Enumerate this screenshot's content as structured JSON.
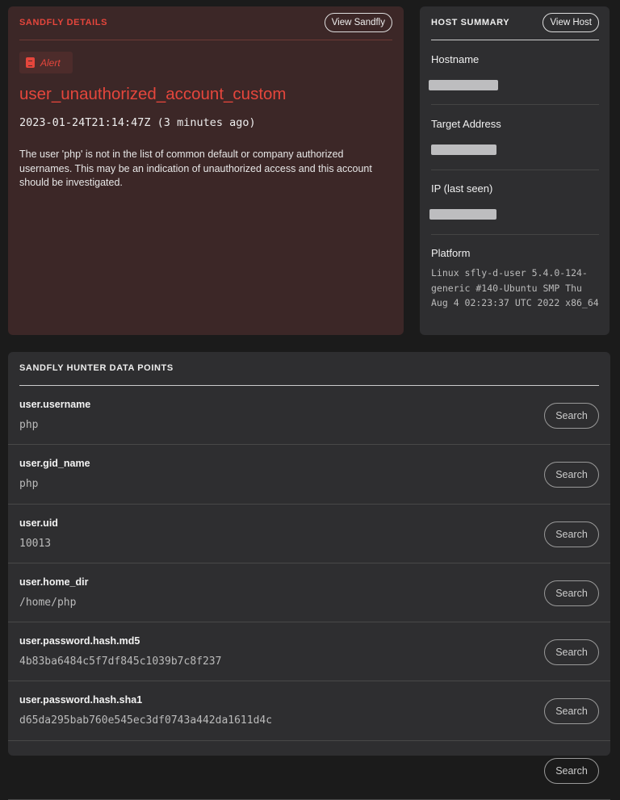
{
  "sandfly": {
    "title": "SANDFLY DETAILS",
    "view_button": "View Sandfly",
    "badge": "Alert",
    "name": "user_unauthorized_account_custom",
    "timestamp": "2023-01-24T21:14:47Z (3 minutes ago)",
    "description": "The user 'php' is not in the list of common default or company authorized usernames. This may be an indication of unauthorized access and this account should be investigated.",
    "accent": "#e5463c"
  },
  "host": {
    "title": "HOST SUMMARY",
    "view_button": "View Host",
    "hostname_label": "Hostname",
    "target_label": "Target Address",
    "ip_label": "IP (last seen)",
    "platform_label": "Platform",
    "platform": "Linux sfly-d-user 5.4.0-124-generic #140-Ubuntu SMP Thu Aug 4 02:23:37 UTC 2022 x86_64"
  },
  "hunter": {
    "title": "SANDFLY HUNTER DATA POINTS",
    "search_label": "Search",
    "rows": [
      {
        "label": "user.username",
        "value": "php"
      },
      {
        "label": "user.gid_name",
        "value": "php"
      },
      {
        "label": "user.uid",
        "value": "10013"
      },
      {
        "label": "user.home_dir",
        "value": "/home/php"
      },
      {
        "label": "user.password.hash.md5",
        "value": "4b83ba6484c5f7df845c1039b7c8f237"
      },
      {
        "label": "user.password.hash.sha1",
        "value": "d65da295bab760e545ec3df0743a442da1611d4c"
      },
      {
        "label": "",
        "value": ""
      }
    ]
  }
}
